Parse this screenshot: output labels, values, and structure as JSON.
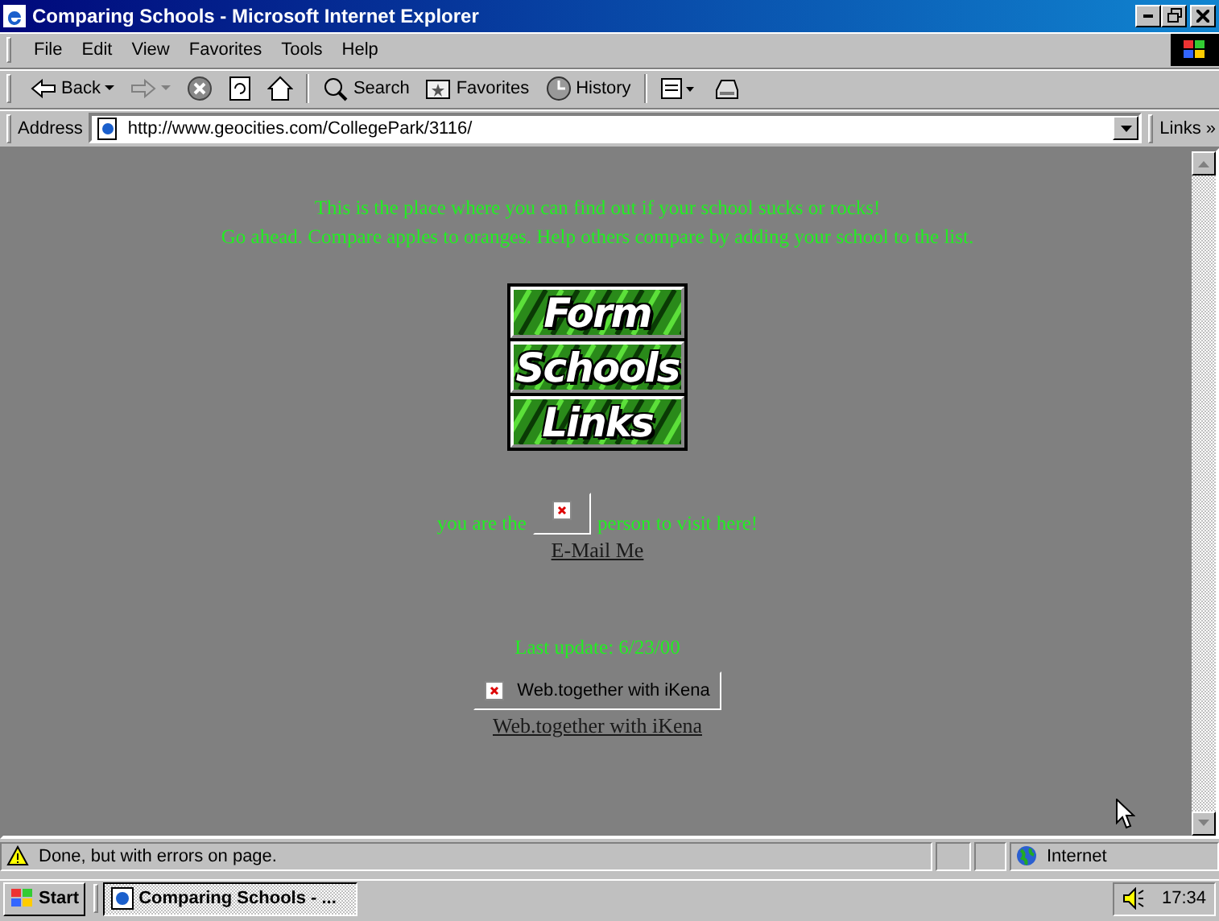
{
  "window": {
    "title": "Comparing Schools - Microsoft Internet Explorer"
  },
  "menu": [
    {
      "label": "File"
    },
    {
      "label": "Edit"
    },
    {
      "label": "View"
    },
    {
      "label": "Favorites"
    },
    {
      "label": "Tools"
    },
    {
      "label": "Help"
    }
  ],
  "toolbar": [
    {
      "kind": "back",
      "label": "Back"
    },
    {
      "kind": "forward"
    },
    {
      "kind": "stop"
    },
    {
      "kind": "refresh"
    },
    {
      "kind": "home"
    },
    {
      "kind": "search",
      "label": "Search"
    },
    {
      "kind": "favorites",
      "label": "Favorites"
    },
    {
      "kind": "history",
      "label": "History"
    },
    {
      "kind": "mail"
    },
    {
      "kind": "print"
    }
  ],
  "address": {
    "label": "Address",
    "value": "http://www.geocities.com/CollegePark/3116/",
    "links": "Links",
    "more": "»"
  },
  "page": {
    "intro": [
      "This is the place where you can find out if your school sucks or rocks!",
      "Go ahead. Compare apples to oranges. Help others compare by adding your school to the list."
    ],
    "nav_buttons": [
      {
        "label": "Form"
      },
      {
        "label": "Schools"
      },
      {
        "label": "Links"
      }
    ],
    "counter": {
      "before": "you are the",
      "after": "person to visit here!"
    },
    "email_link": "E-Mail Me",
    "last_update": "Last update: 6/23/00",
    "badge": {
      "alt": "Web.together with iKena"
    },
    "badge_link": "Web.together with iKena"
  },
  "status_bar": {
    "text": "Done, but with errors on page.",
    "zone": "Internet"
  },
  "taskbar": {
    "start": "Start",
    "tasks": [
      {
        "label": "Comparing Schools - ...",
        "selected": true
      }
    ],
    "clock": "17:34"
  }
}
